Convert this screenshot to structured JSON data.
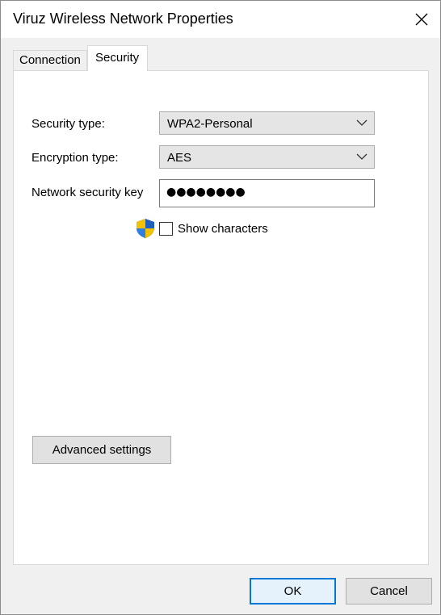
{
  "window": {
    "title": "Viruz Wireless Network Properties",
    "close_icon": "close-icon"
  },
  "tabs": [
    {
      "label": "Connection",
      "selected": false
    },
    {
      "label": "Security",
      "selected": true
    }
  ],
  "security": {
    "security_type_label": "Security type:",
    "security_type_value": "WPA2-Personal",
    "encryption_type_label": "Encryption type:",
    "encryption_type_value": "AES",
    "network_key_label": "Network security key",
    "network_key_masked": "●●●●●●●●",
    "show_characters_label": "Show characters",
    "show_characters_checked": false,
    "shield_icon": "uac-shield-icon"
  },
  "buttons": {
    "advanced_settings": "Advanced settings",
    "ok": "OK",
    "cancel": "Cancel"
  },
  "colors": {
    "accent": "#0078d7",
    "window_bg": "#f0f0f0",
    "panel_bg": "#ffffff"
  }
}
